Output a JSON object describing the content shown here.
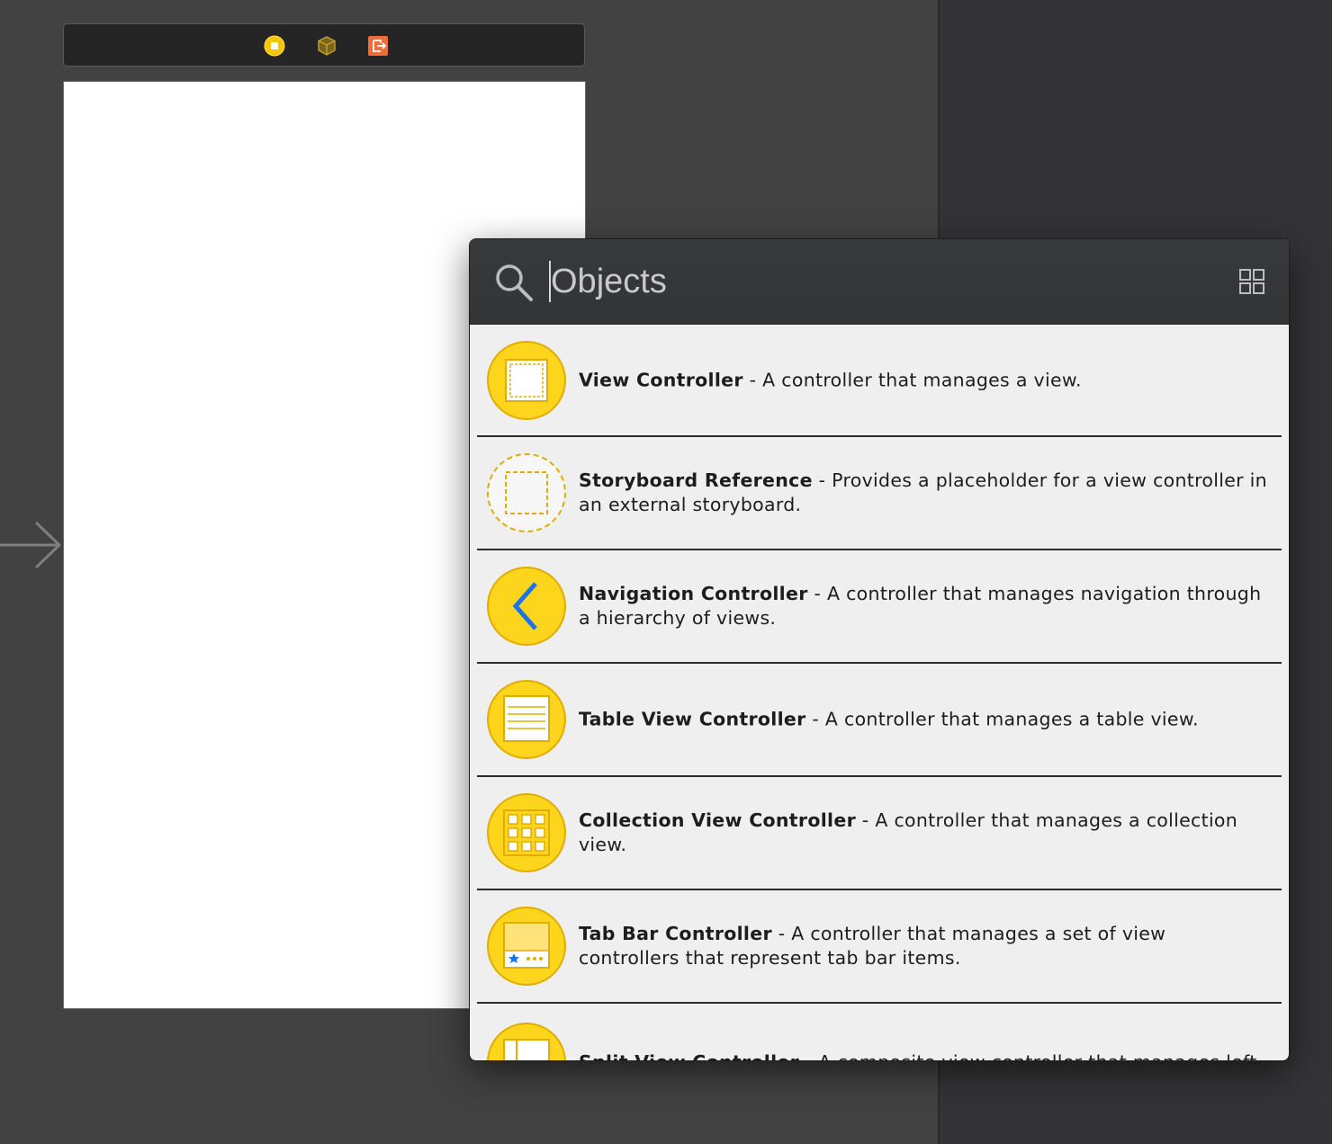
{
  "scene_dock": {
    "icons": [
      "view-controller-icon",
      "first-responder-icon",
      "exit-icon"
    ],
    "colors": {
      "view_controller": "#f5c400",
      "first_responder": "#c9a227",
      "exit": "#f26b3a"
    }
  },
  "library": {
    "search": {
      "placeholder": "Objects",
      "value": ""
    },
    "items": [
      {
        "title": "View Controller",
        "separator": " - ",
        "description": "A controller that manages a view.",
        "icon": "view-controller-icon"
      },
      {
        "title": "Storyboard Reference",
        "separator": " - ",
        "description": "Provides a placeholder for a view controller in an external storyboard.",
        "icon": "storyboard-reference-icon"
      },
      {
        "title": "Navigation Controller",
        "separator": " - ",
        "description": "A controller that manages navigation through a hierarchy of views.",
        "icon": "navigation-controller-icon"
      },
      {
        "title": "Table View Controller",
        "separator": " - ",
        "description": "A controller that manages a table view.",
        "icon": "table-view-controller-icon"
      },
      {
        "title": "Collection View Controller",
        "separator": " - ",
        "description": "A controller that manages a collection view.",
        "icon": "collection-view-controller-icon"
      },
      {
        "title": "Tab Bar Controller",
        "separator": " - ",
        "description": "A controller that manages a set of view controllers that represent tab bar items.",
        "icon": "tab-bar-controller-icon"
      },
      {
        "title": "Split View Controller",
        "separator": " - ",
        "description": "A composite view controller that manages left and",
        "icon": "split-view-controller-icon"
      }
    ],
    "accent_colors": {
      "icon_fill": "#fdd51c",
      "icon_stroke": "#e0ad00",
      "blue": "#1a73e8"
    }
  }
}
